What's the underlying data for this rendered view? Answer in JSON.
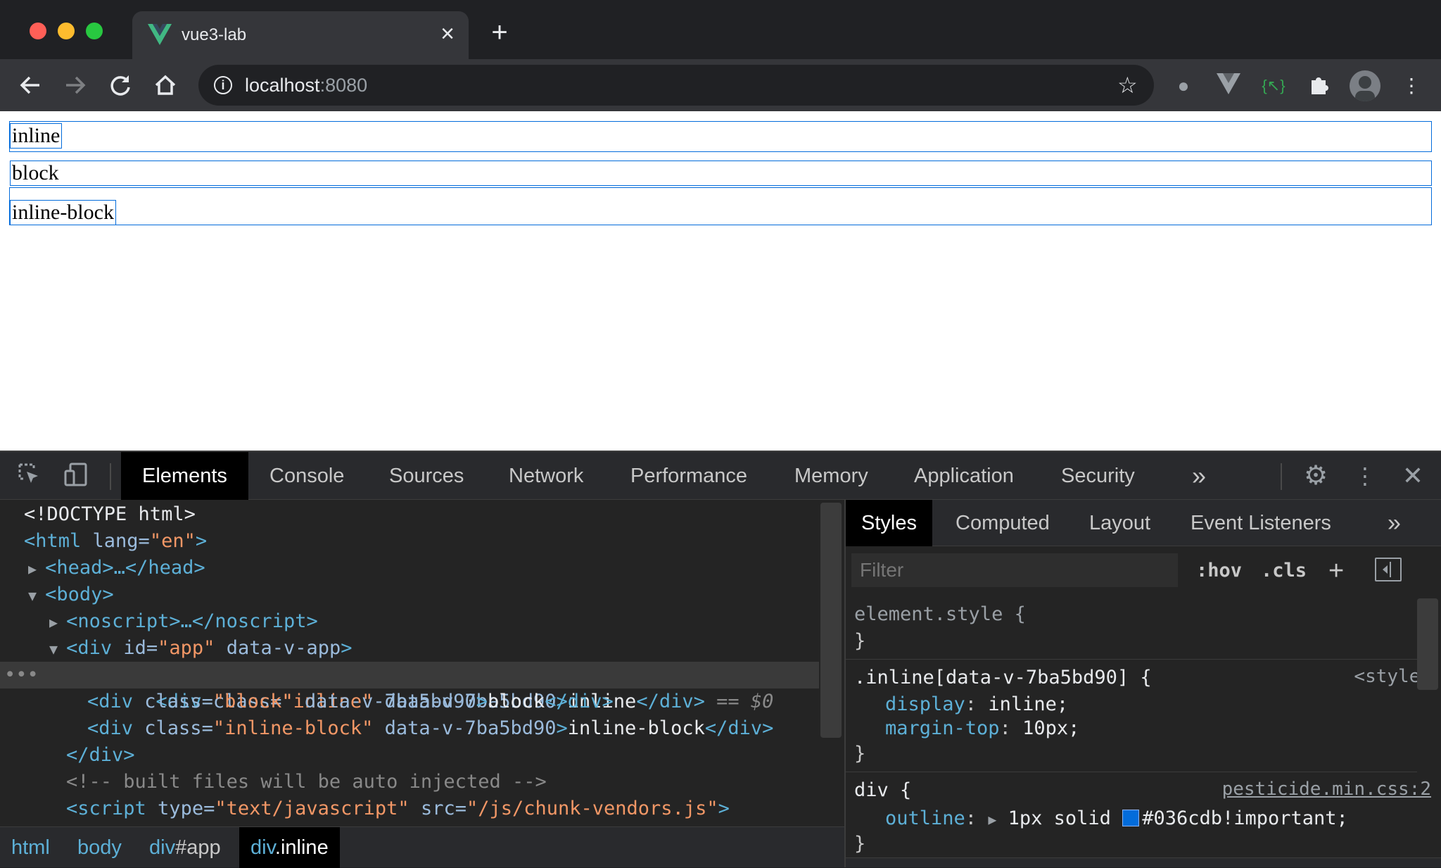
{
  "browser": {
    "tab_title": "vue3-lab",
    "url_host": "localhost",
    "url_port": ":8080",
    "icons": [
      "back-icon",
      "forward-icon",
      "reload-icon",
      "home-icon",
      "info-icon",
      "star-icon",
      "extension-icon",
      "vue-devtools-icon",
      "selector-extension-icon",
      "puzzle-icon",
      "avatar",
      "more-menu-icon"
    ]
  },
  "page": {
    "items": [
      "inline",
      "block",
      "inline-block"
    ]
  },
  "devtools": {
    "tabs": [
      "Elements",
      "Console",
      "Sources",
      "Network",
      "Performance",
      "Memory",
      "Application",
      "Security"
    ],
    "more": "»",
    "dom": {
      "doctype": "<!DOCTYPE html>",
      "html_open": "<html",
      "lang_attr": " lang=",
      "lang_val": "\"en\"",
      "gt": ">",
      "head": "<head>…</head>",
      "body": "<body>",
      "noscript": "<noscript>…</noscript>",
      "app_open": "<div",
      "app_attr": " id=",
      "app_val": "\"app\"",
      "app_attr2": " data-v-app",
      "div_open": "<div",
      "class_attr": " class=",
      "scoped_attr": " data-v-7ba5bd90",
      "div_close": "</div>",
      "rows": [
        {
          "cls": "\"inline\"",
          "text": "inline"
        },
        {
          "cls": "\"block\"",
          "text": "block"
        },
        {
          "cls": "\"inline-block\"",
          "text": "inline-block"
        }
      ],
      "selected_marker": " == ",
      "selected_dollar": "$0",
      "ellipsis": "•••",
      "comment": "<!-- built files will be auto injected -->",
      "script_open": "<script",
      "type_attr": " type=",
      "type_val": "\"text/javascript\"",
      "src_attr": " src=",
      "src_val": "\"/js/chunk-vendors.js\""
    },
    "breadcrumb": [
      {
        "tag": "html",
        "rest": ""
      },
      {
        "tag": "body",
        "rest": ""
      },
      {
        "tag": "div",
        "rest": "#app"
      },
      {
        "tag": "div",
        "rest": ".inline"
      }
    ],
    "styles": {
      "tabs": [
        "Styles",
        "Computed",
        "Layout",
        "Event Listeners"
      ],
      "more": "»",
      "filter_placeholder": "Filter",
      "hov": ":hov",
      "cls": ".cls",
      "plus": "+",
      "element_style": "element.style {",
      "close_brace": "}",
      "rule1_selector": ".inline[data-v-7ba5bd90] {",
      "rule1_source": "<style>",
      "rule1_props": [
        {
          "name": "display",
          "value": "inline;"
        },
        {
          "name": "margin-top",
          "value": "10px;"
        }
      ],
      "rule2_selector": "div {",
      "rule2_source": "pesticide.min.css:2",
      "rule2_prop": "outline",
      "rule2_value_pre": "1px solid ",
      "rule2_color": "#036cdb",
      "rule2_value_post": "#036cdb!important;"
    }
  }
}
